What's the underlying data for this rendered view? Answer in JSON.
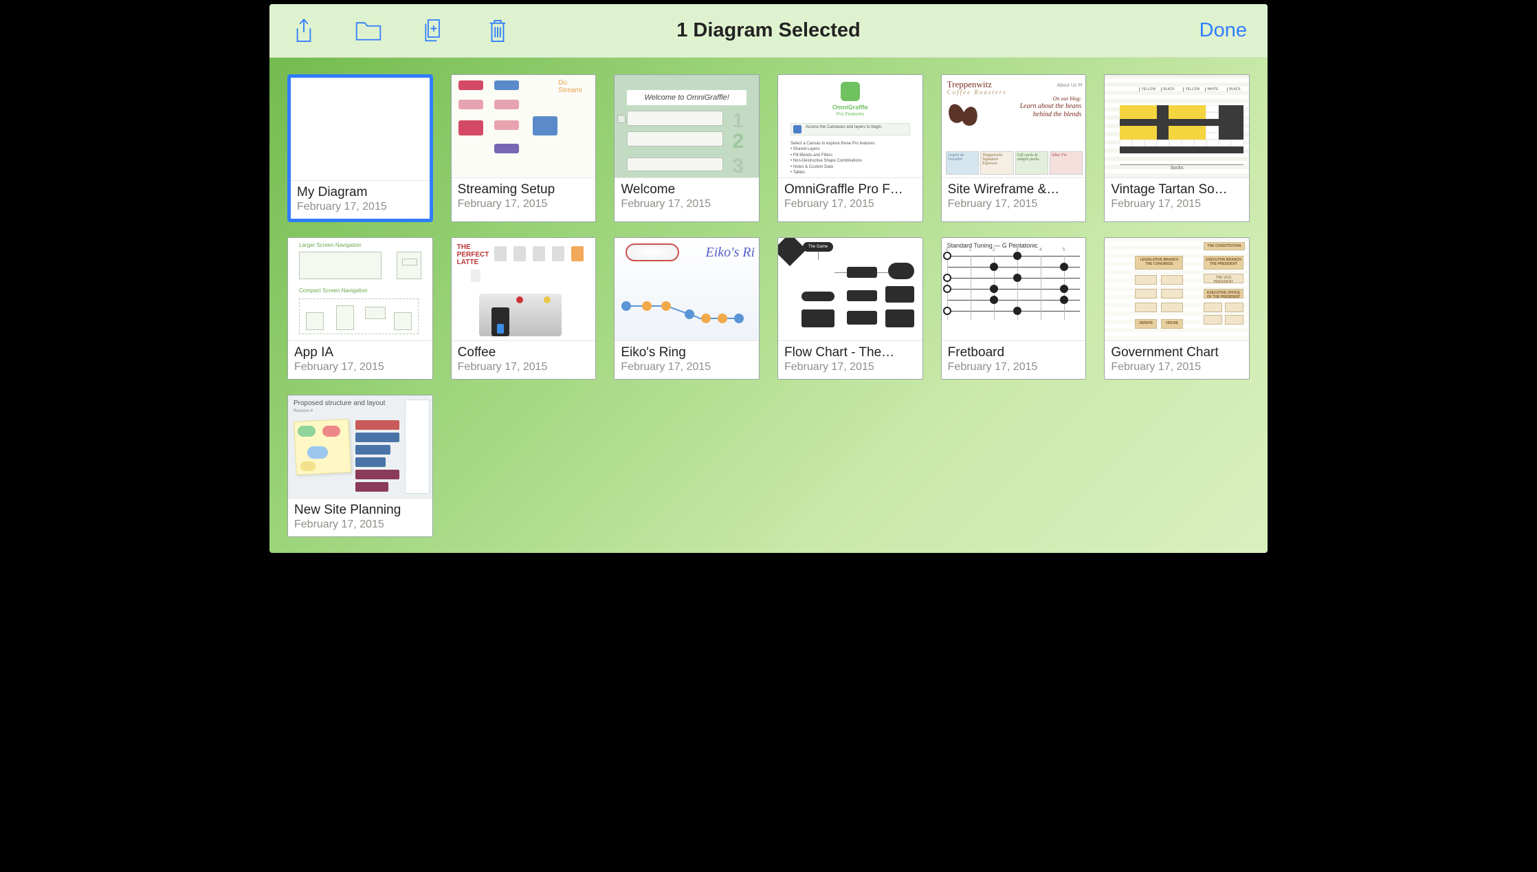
{
  "toolbar": {
    "title": "1 Diagram Selected",
    "done_label": "Done",
    "icons": {
      "share": "share-icon",
      "folder": "folder-icon",
      "new": "new-document-icon",
      "delete": "trash-icon"
    }
  },
  "selected_index": 0,
  "documents": [
    {
      "title": "My Diagram",
      "date": "February 17, 2015",
      "thumb": "blank",
      "selected": true
    },
    {
      "title": "Streaming Setup",
      "date": "February 17, 2015",
      "thumb": "streaming"
    },
    {
      "title": "Welcome",
      "date": "February 17, 2015",
      "thumb": "welcome",
      "content": {
        "banner": "Welcome to OmniGraffle!"
      }
    },
    {
      "title": "OmniGraffle Pro F…",
      "date": "February 17, 2015",
      "thumb": "pro",
      "content": {
        "logo_line1": "OmniGraffle",
        "logo_line2": "Pro Features",
        "strip": "Access the Canvases and layers to begin.",
        "list_header": "Select a Canvas to explore these Pro features:",
        "list": [
          "Shared Layers",
          "Fill Blends and Filters",
          "Non-Destructive Shape Combinations",
          "Notes & Custom Data",
          "Tables"
        ]
      }
    },
    {
      "title": "Site Wireframe &…",
      "date": "February 17, 2015",
      "thumb": "site",
      "content": {
        "brand": "Treppenwitz",
        "brand_sub": "Coffee Roasters",
        "nav": "About Us   Pr",
        "blog_line1": "On our blog:",
        "blog_line2": "Learn about the beans",
        "blog_line3": "behind the blends",
        "cards": [
          "l'esprit de l'escalier",
          "Treppenwitz Signature Espresso",
          "Gift cards & sample packs",
          "Siber Fie"
        ]
      }
    },
    {
      "title": "Vintage Tartan So…",
      "date": "February 17, 2015",
      "thumb": "tartan",
      "content": {
        "footer": "Socks",
        "labels": [
          "YELLOW",
          "BLACK",
          "YELLOW",
          "WHITE",
          "BLACK"
        ]
      }
    },
    {
      "title": "App IA",
      "date": "February 17, 2015",
      "thumb": "appia",
      "content": {
        "heading1": "Larger Screen Navigation",
        "heading2": "Compact Screen Navigation"
      }
    },
    {
      "title": "Coffee",
      "date": "February 17, 2015",
      "thumb": "coffee",
      "content": {
        "heading": "THE PERFECT LATTE"
      }
    },
    {
      "title": "Eiko's Ring",
      "date": "February 17, 2015",
      "thumb": "eiko",
      "content": {
        "title": "Eiko's Ri"
      }
    },
    {
      "title": "Flow Chart - The…",
      "date": "February 17, 2015",
      "thumb": "flow",
      "content": {
        "top": "The Game"
      }
    },
    {
      "title": "Fretboard",
      "date": "February 17, 2015",
      "thumb": "fret",
      "content": {
        "title": "Standard Tuning — G Pentatonic",
        "frets": [
          "0",
          "1",
          "2",
          "3",
          "4",
          "5"
        ]
      }
    },
    {
      "title": "Government Chart",
      "date": "February 17, 2015",
      "thumb": "gov",
      "content": {
        "top": "THE CONSTITUTION",
        "cols": [
          "LEGISLATIVE BRANCH THE CONGRESS",
          "EXECUTIVE BRANCH THE PRESIDENT"
        ],
        "cells": [
          "SENATE",
          "HOUSE",
          "THE VICE PRESIDENT",
          "EXECUTIVE OFFICE OF THE PRESIDENT"
        ]
      }
    },
    {
      "title": "New Site Planning",
      "date": "February 17, 2015",
      "thumb": "site2",
      "content": {
        "title": "Proposed structure and layout",
        "sub": "Revision 4"
      }
    }
  ]
}
